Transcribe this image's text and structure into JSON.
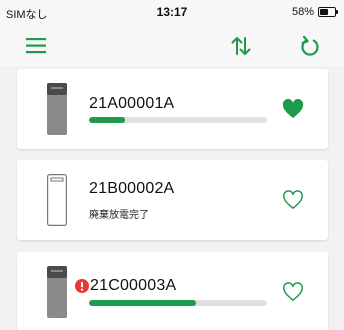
{
  "status_bar": {
    "carrier": "SIMなし",
    "time": "13:17",
    "battery_text": "58%",
    "battery_level": 0.58
  },
  "nav": {
    "menu_icon": "hamburger-menu-icon",
    "sort_icon": "sort-arrows-icon",
    "refresh_icon": "refresh-icon"
  },
  "devices": [
    {
      "id": "21A00001A",
      "favorite": true,
      "alert": false,
      "status_text": "",
      "progress": 0.2,
      "device_style": "filled"
    },
    {
      "id": "21B00002A",
      "favorite": false,
      "alert": false,
      "status_text": "廃棄放電完了",
      "progress": null,
      "device_style": "outline"
    },
    {
      "id": "21C00003A",
      "favorite": false,
      "alert": true,
      "status_text": "",
      "progress": 0.6,
      "device_style": "filled"
    }
  ],
  "colors": {
    "accent": "#1e9a4a",
    "alert": "#e53935",
    "device_fill": "#8a8a8a",
    "device_top": "#4a4a4a"
  }
}
